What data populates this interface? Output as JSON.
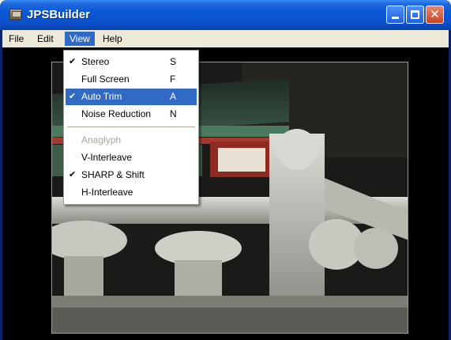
{
  "window": {
    "title": "JPSBuilder"
  },
  "title_buttons": {
    "close": "✕"
  },
  "menubar": [
    {
      "label": "File"
    },
    {
      "label": "Edit"
    },
    {
      "label": "View"
    },
    {
      "label": "Help"
    }
  ],
  "view_menu": {
    "items": [
      {
        "label": "Stereo",
        "shortcut": "S",
        "checked": true,
        "check": "✔"
      },
      {
        "label": "Full Screen",
        "shortcut": "F",
        "checked": false
      },
      {
        "label": "Auto Trim",
        "shortcut": "A",
        "checked": true,
        "check": "✔",
        "highlighted": true
      },
      {
        "label": "Noise Reduction",
        "shortcut": "N",
        "checked": false
      },
      {
        "label": "Anaglyph",
        "shortcut": "",
        "checked": false,
        "disabled": true
      },
      {
        "label": "V-Interleave",
        "shortcut": "",
        "checked": false
      },
      {
        "label": "SHARP & Shift",
        "shortcut": "",
        "checked": true,
        "check": "✔"
      },
      {
        "label": "H-Interleave",
        "shortcut": "",
        "checked": false
      }
    ]
  },
  "colors": {
    "titlebar": "#0a58d6",
    "menu_highlight": "#316ac5",
    "menubar_bg": "#ece9d8",
    "close_button": "#c74424"
  }
}
